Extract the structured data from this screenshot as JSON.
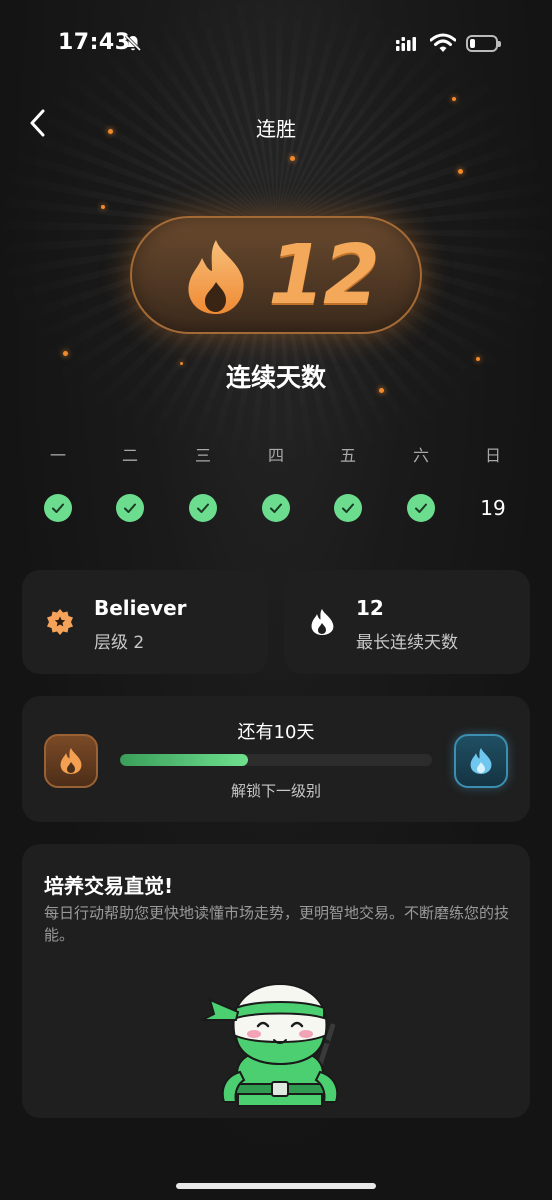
{
  "status_bar": {
    "time": "17:43"
  },
  "nav": {
    "title": "连胜"
  },
  "streak": {
    "count": "12",
    "label": "连续天数"
  },
  "week": {
    "days": [
      {
        "name": "一",
        "completed": true,
        "date": ""
      },
      {
        "name": "二",
        "completed": true,
        "date": ""
      },
      {
        "name": "三",
        "completed": true,
        "date": ""
      },
      {
        "name": "四",
        "completed": true,
        "date": ""
      },
      {
        "name": "五",
        "completed": true,
        "date": ""
      },
      {
        "name": "六",
        "completed": true,
        "date": ""
      },
      {
        "name": "日",
        "completed": false,
        "date": "19"
      }
    ]
  },
  "level_card": {
    "title": "Believer",
    "subtitle": "层级 2"
  },
  "best_card": {
    "title": "12",
    "subtitle": "最长连续天数"
  },
  "progress": {
    "top_text": "还有10天",
    "bottom_text": "解锁下一级别",
    "fill_percent": 41
  },
  "promo": {
    "title": "培养交易直觉!",
    "text": "每日行动帮助您更快地读懂市场走势，更明智地交易。不断磨练您的技能。"
  },
  "colors": {
    "accent_orange": "#f08a2c",
    "check_green": "#6cdd8e",
    "card_bg": "#1f1f1f",
    "page_bg": "#141414"
  }
}
